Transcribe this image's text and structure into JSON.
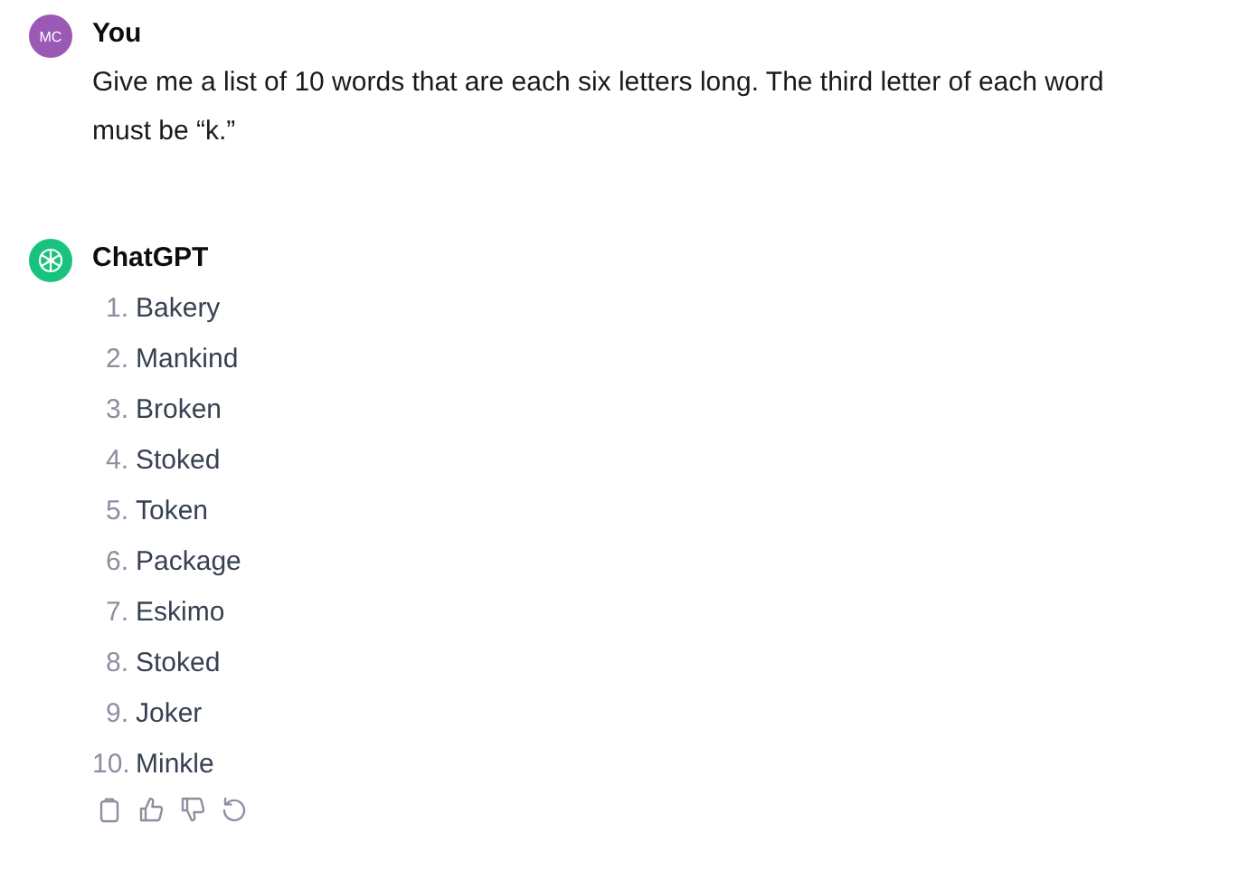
{
  "messages": [
    {
      "kind": "user",
      "avatar": "MC",
      "author": "You",
      "text": "Give me a list of 10 words that are each six letters long. The third letter of each word must be “k.”"
    },
    {
      "kind": "assistant",
      "author": "ChatGPT",
      "items": [
        {
          "number": "1.",
          "text": "Bakery"
        },
        {
          "number": "2.",
          "text": "Mankind"
        },
        {
          "number": "3.",
          "text": "Broken"
        },
        {
          "number": "4.",
          "text": "Stoked"
        },
        {
          "number": "5.",
          "text": "Token"
        },
        {
          "number": "6.",
          "text": "Package"
        },
        {
          "number": "7.",
          "text": "Eskimo"
        },
        {
          "number": "8.",
          "text": "Stoked"
        },
        {
          "number": "9.",
          "text": "Joker"
        },
        {
          "number": "10.",
          "text": "Minkle"
        }
      ],
      "actions": [
        {
          "kind": "copy"
        },
        {
          "kind": "like"
        },
        {
          "kind": "dislike"
        },
        {
          "kind": "regenerate"
        }
      ]
    }
  ]
}
